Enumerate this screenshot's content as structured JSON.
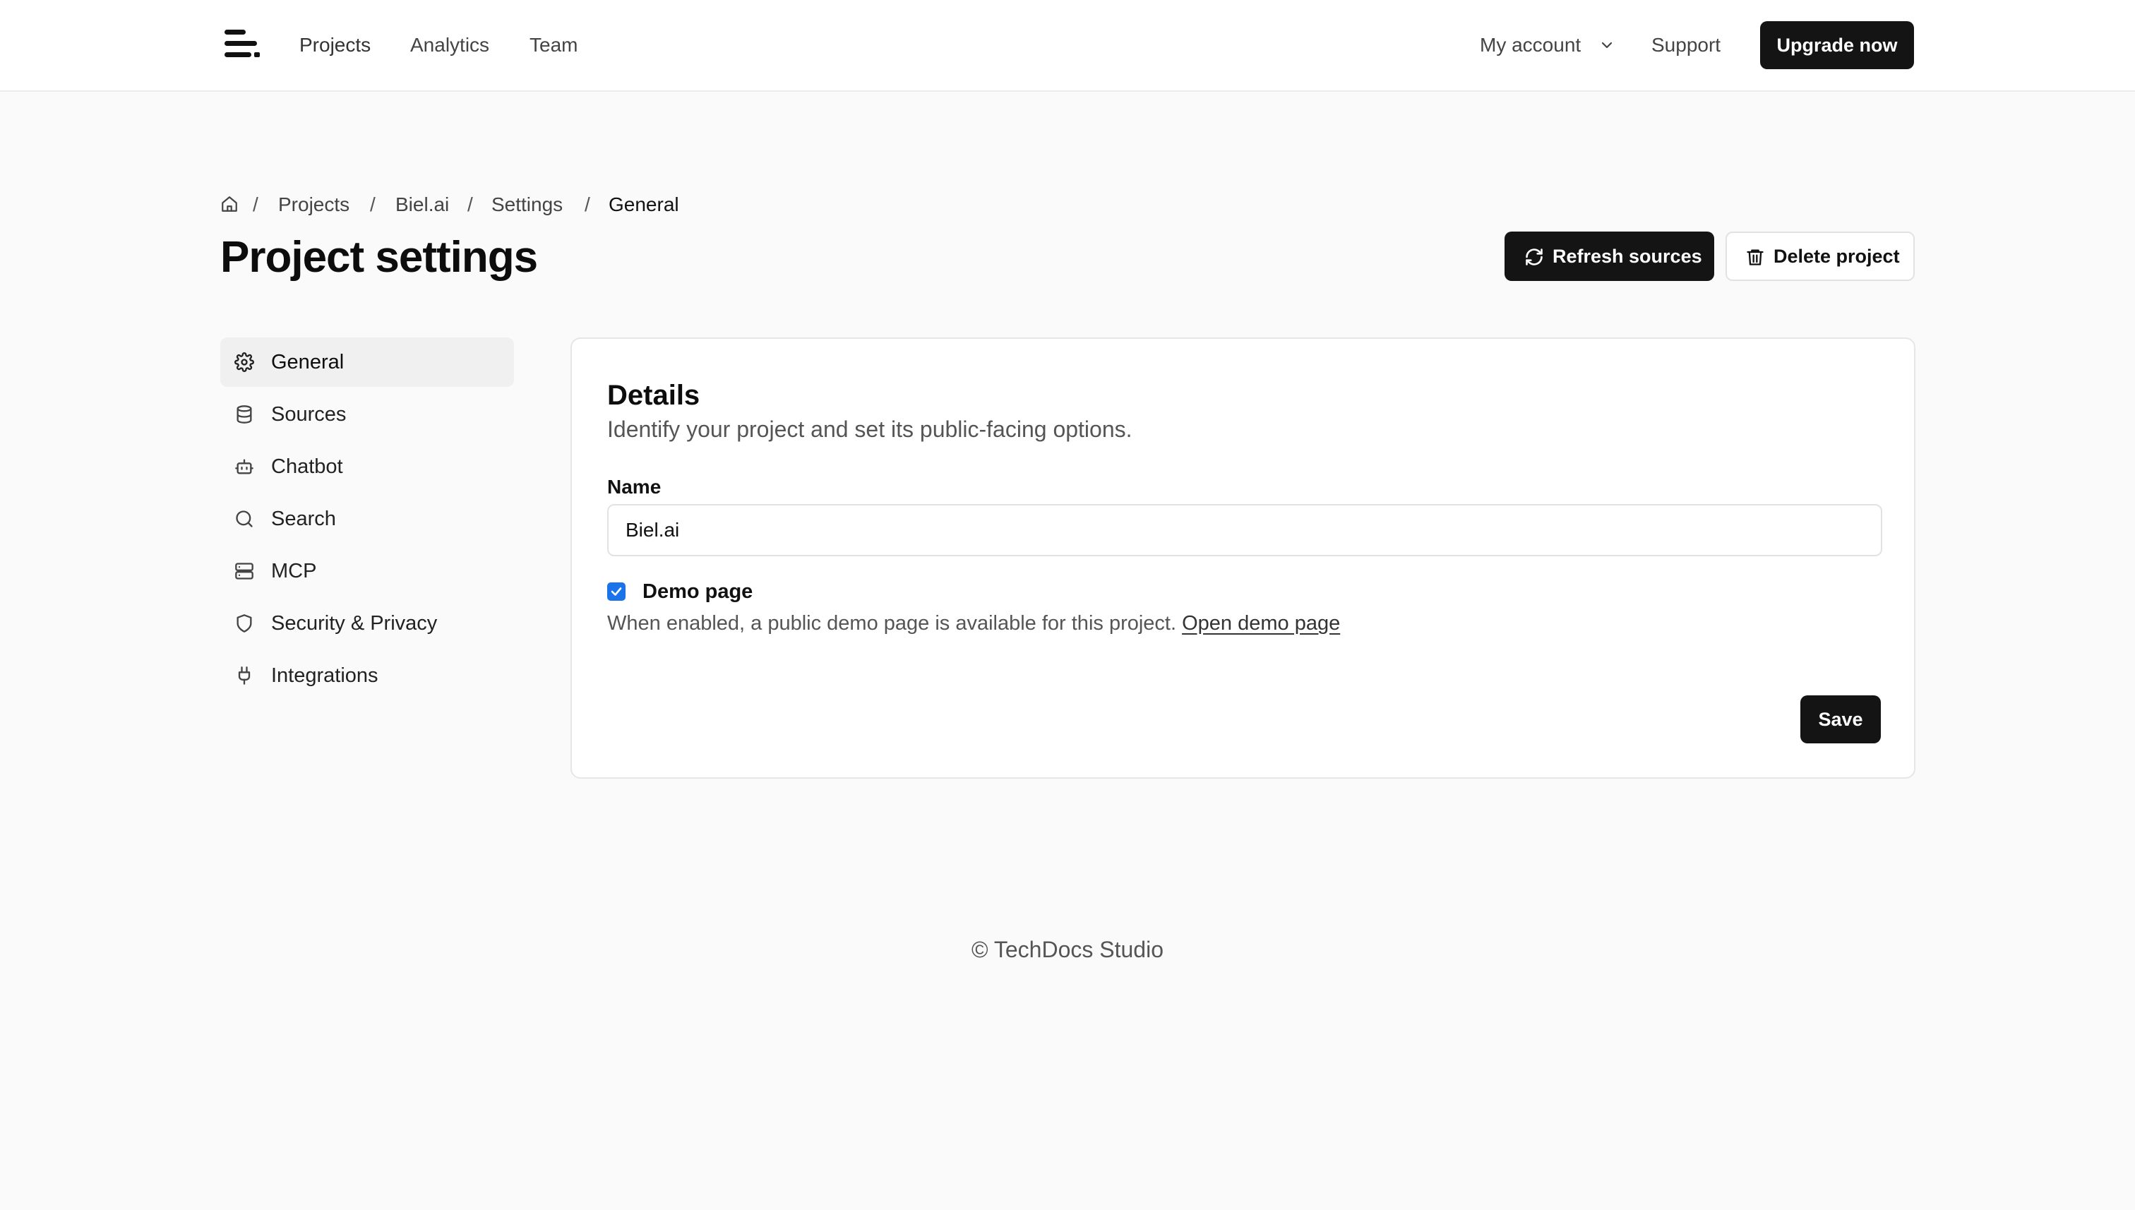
{
  "nav": {
    "links": [
      "Projects",
      "Analytics",
      "Team"
    ],
    "account_label": "My account",
    "support_label": "Support",
    "upgrade_label": "Upgrade now"
  },
  "breadcrumb": {
    "items": [
      "Projects",
      "Biel.ai",
      "Settings"
    ],
    "current": "General",
    "separator": "/"
  },
  "page": {
    "title": "Project settings",
    "refresh_label": "Refresh sources",
    "delete_label": "Delete project"
  },
  "sidebar": {
    "active": "General",
    "items": [
      {
        "label": "General",
        "icon": "gear-icon"
      },
      {
        "label": "Sources",
        "icon": "database-icon"
      },
      {
        "label": "Chatbot",
        "icon": "robot-icon"
      },
      {
        "label": "Search",
        "icon": "search-icon"
      },
      {
        "label": "MCP",
        "icon": "server-icon"
      },
      {
        "label": "Security & Privacy",
        "icon": "shield-icon"
      },
      {
        "label": "Integrations",
        "icon": "plug-icon"
      }
    ]
  },
  "details": {
    "title": "Details",
    "subtitle": "Identify your project and set its public-facing options.",
    "name_label": "Name",
    "name_value": "Biel.ai",
    "demo_label": "Demo page",
    "demo_checked": true,
    "demo_help": "When enabled, a public demo page is available for this project.",
    "demo_link": "Open demo page",
    "save_label": "Save"
  },
  "footer": {
    "text": "© TechDocs Studio"
  },
  "colors": {
    "primary_button": "#141414",
    "page_background": "#fafafa",
    "checkbox_accent": "#1a73e8"
  }
}
